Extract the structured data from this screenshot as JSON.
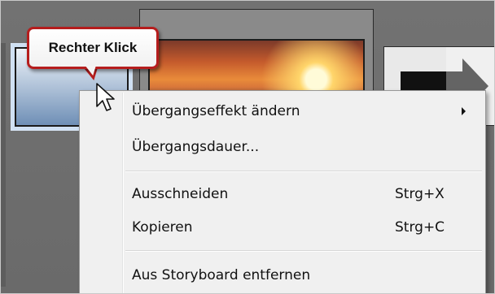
{
  "callout": {
    "text": "Rechter Klick"
  },
  "menu": {
    "items": [
      {
        "label": "Übergangseffekt ändern",
        "shortcut": "",
        "submenu": true
      },
      {
        "label": "Übergangsdauer...",
        "shortcut": ""
      },
      {
        "label": "Ausschneiden",
        "shortcut": "Strg+X"
      },
      {
        "label": "Kopieren",
        "shortcut": "Strg+C"
      },
      {
        "label": "Aus Storyboard entfernen",
        "shortcut": ""
      }
    ]
  },
  "icons": {
    "cursor": "mouse-pointer-icon",
    "submenu_arrow": "chevron-right-icon",
    "transition_thumbnail": "arrow-right-icon"
  },
  "colors": {
    "callout_border": "#b51d1d",
    "menu_background": "#f0f0f0",
    "workspace_background": "#6d6d6d"
  }
}
